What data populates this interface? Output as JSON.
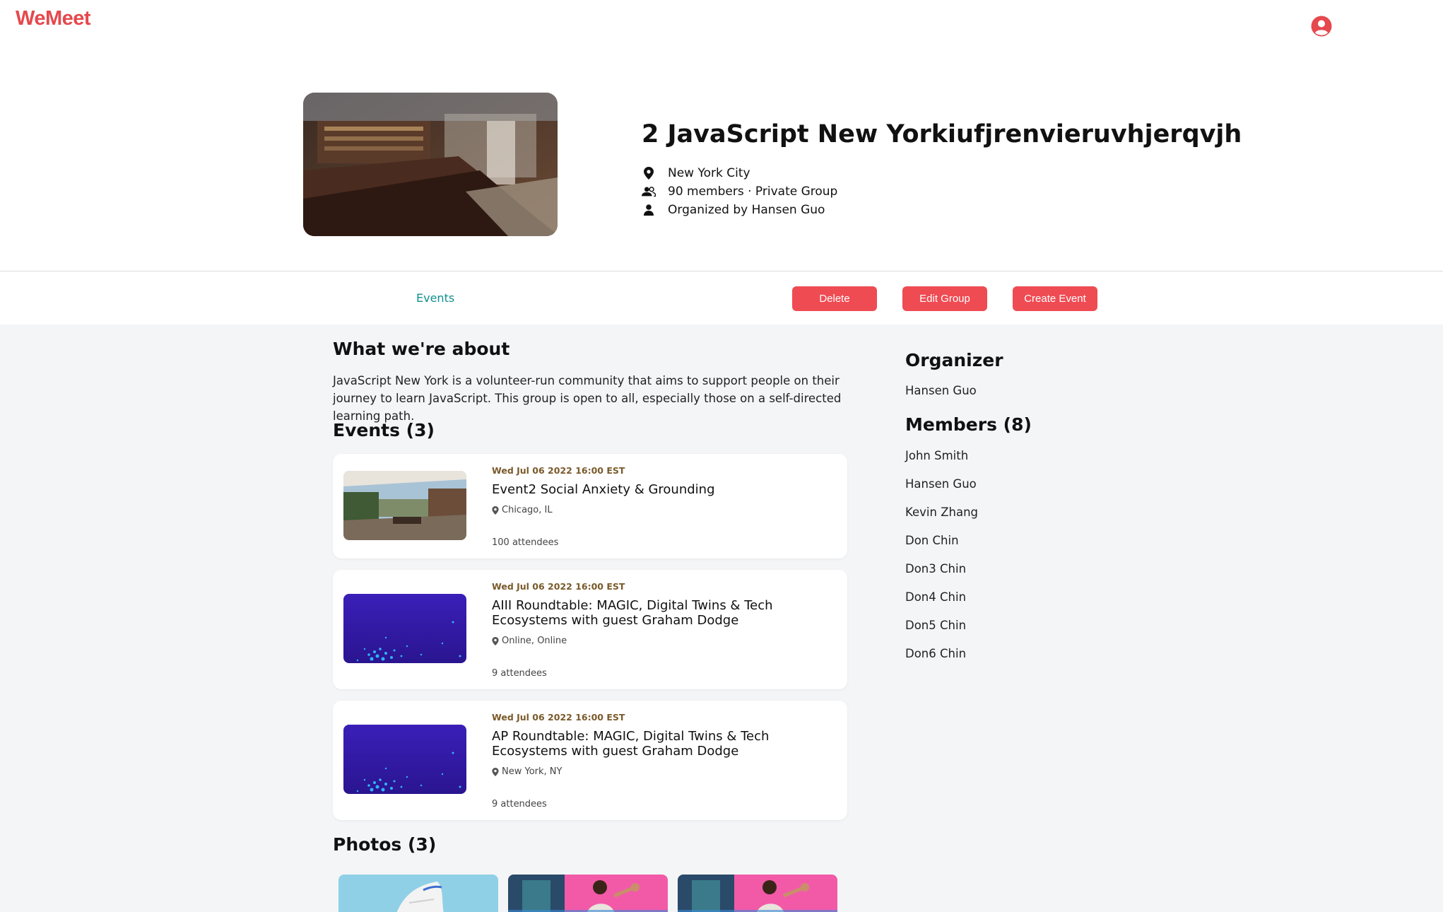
{
  "brand": {
    "name": "WeMeet",
    "color": "#e5484d"
  },
  "nav": {
    "avatar_icon": "user-circle-icon"
  },
  "group": {
    "title": "2 JavaScript New Yorkiufjrenvieruvhjerqvjh",
    "location": "New York City",
    "members_line": "90 members · Private Group",
    "organized_by": "Organized by Hansen Guo"
  },
  "tabs": {
    "events": "Events"
  },
  "actions": {
    "delete": "Delete",
    "edit": "Edit Group",
    "create": "Create Event"
  },
  "about": {
    "heading": "What we're about",
    "text": "JavaScript New York is a volunteer-run community that aims to support people on their journey to learn JavaScript. This group is open to all, especially those on a self-directed learning path."
  },
  "events": {
    "heading": "Events (3)",
    "items": [
      {
        "date": "Wed Jul 06 2022 16:00 EST",
        "title": "Event2 Social Anxiety & Grounding",
        "location": "Chicago, IL",
        "attendees": "100 attendees"
      },
      {
        "date": "Wed Jul 06 2022 16:00 EST",
        "title": "AIII Roundtable: MAGIC, Digital Twins & Tech Ecosystems with guest Graham Dodge",
        "location": "Online, Online",
        "attendees": "9 attendees"
      },
      {
        "date": "Wed Jul 06 2022 16:00 EST",
        "title": "AP Roundtable: MAGIC, Digital Twins & Tech Ecosystems with guest Graham Dodge",
        "location": "New York, NY",
        "attendees": "9 attendees"
      }
    ]
  },
  "photos": {
    "heading": "Photos (3)"
  },
  "organizer": {
    "heading": "Organizer",
    "name": "Hansen Guo"
  },
  "members": {
    "heading": "Members (8)",
    "items": [
      "John Smith",
      "Hansen Guo",
      "Kevin Zhang",
      "Don Chin",
      "Don3 Chin",
      "Don4 Chin",
      "Don5 Chin",
      "Don6 Chin"
    ]
  },
  "colors": {
    "accent": "#ef4b53",
    "tab_active": "#0f8f8c",
    "date": "#7a5a2b",
    "background": "#f4f5f7"
  }
}
